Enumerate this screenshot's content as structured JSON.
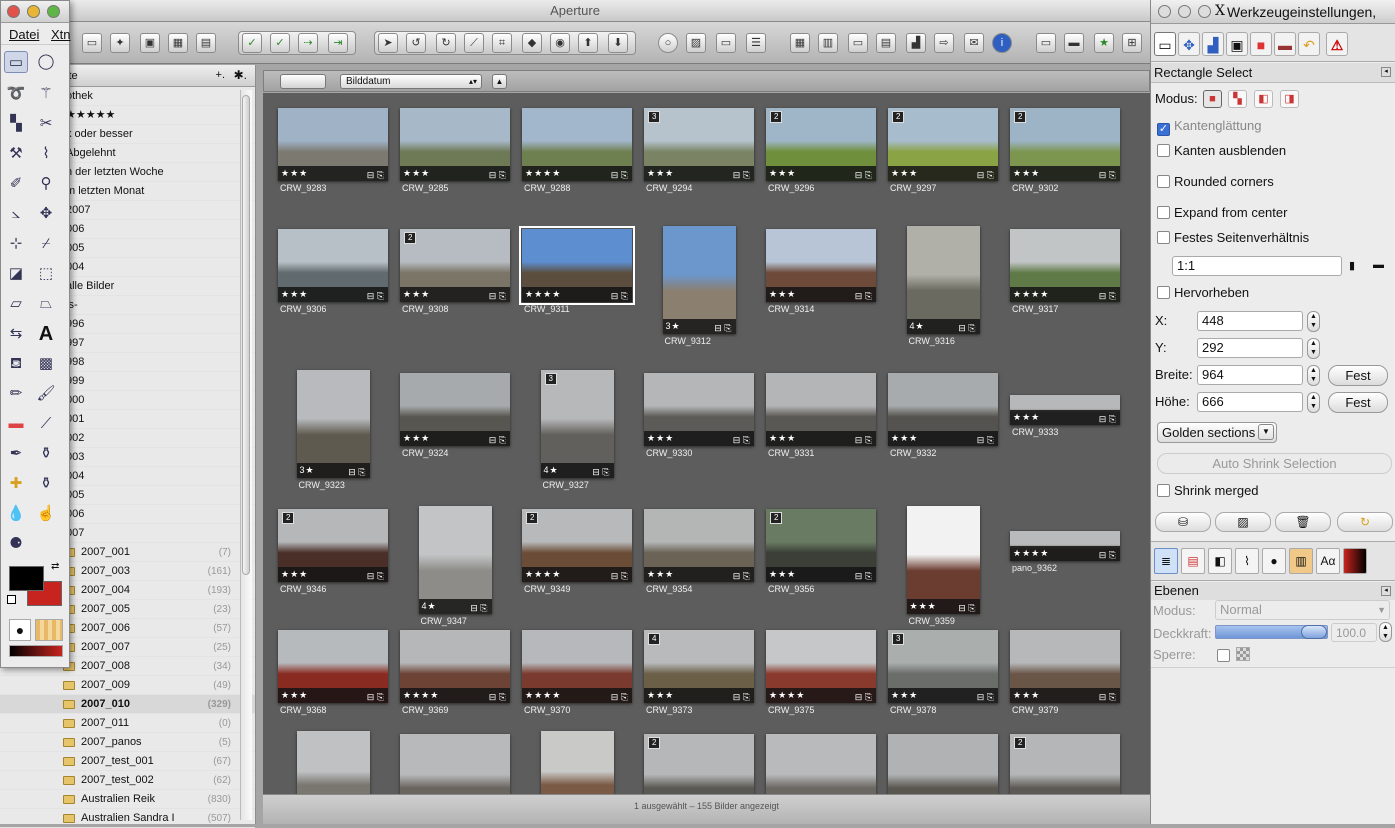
{
  "app": {
    "title": "Aperture"
  },
  "sidebar": {
    "header": "kte",
    "add": "+.",
    "gear": "✱.",
    "rows": [
      {
        "label": "othek",
        "type": "lib"
      },
      {
        "label": "★★★★★",
        "type": "smart"
      },
      {
        "label": "k oder besser",
        "type": "smart"
      },
      {
        "label": "Abgelehnt",
        "type": "smart"
      },
      {
        "label": "n der letzten Woche",
        "type": "smart"
      },
      {
        "label": "m letzten Monat",
        "type": "smart"
      },
      {
        "label": "2007",
        "type": "smart"
      },
      {
        "label": "006",
        "type": "smart"
      },
      {
        "label": "005",
        "type": "smart"
      },
      {
        "label": "004",
        "type": "smart"
      },
      {
        "label": "alle Bilder",
        "type": "smart"
      },
      {
        "label": "ls-",
        "type": "smart"
      },
      {
        "label": "996",
        "type": "smart"
      },
      {
        "label": "997",
        "type": "smart"
      },
      {
        "label": "998",
        "type": "smart"
      },
      {
        "label": "999",
        "type": "smart"
      },
      {
        "label": "000",
        "type": "smart"
      },
      {
        "label": "001",
        "type": "smart"
      },
      {
        "label": "002",
        "type": "smart"
      },
      {
        "label": "003",
        "type": "smart"
      },
      {
        "label": "004",
        "type": "smart"
      },
      {
        "label": "005",
        "type": "smart"
      },
      {
        "label": "006",
        "type": "smart"
      },
      {
        "label": "007",
        "type": "smart"
      },
      {
        "label": "2007_001",
        "count": "(7)",
        "type": "folder"
      },
      {
        "label": "2007_003",
        "count": "(161)",
        "type": "folder"
      },
      {
        "label": "2007_004",
        "count": "(193)",
        "type": "folder"
      },
      {
        "label": "2007_005",
        "count": "(23)",
        "type": "folder"
      },
      {
        "label": "2007_006",
        "count": "(57)",
        "type": "folder"
      },
      {
        "label": "2007_007",
        "count": "(25)",
        "type": "folder"
      },
      {
        "label": "2007_008",
        "count": "(34)",
        "type": "folder"
      },
      {
        "label": "2007_009",
        "count": "(49)",
        "type": "folder"
      },
      {
        "label": "2007_010",
        "count": "(329)",
        "type": "folder",
        "selected": true
      },
      {
        "label": "2007_011",
        "count": "(0)",
        "type": "folder"
      },
      {
        "label": "2007_panos",
        "count": "(5)",
        "type": "folder"
      },
      {
        "label": "2007_test_001",
        "count": "(67)",
        "type": "folder"
      },
      {
        "label": "2007_test_002",
        "count": "(62)",
        "type": "folder"
      },
      {
        "label": "Australien Reik",
        "count": "(830)",
        "type": "folder"
      },
      {
        "label": "Australien Sandra I",
        "count": "(507)",
        "type": "folder"
      }
    ]
  },
  "browser": {
    "sort_label": "Bilddatum",
    "status": "1 ausgewählt – 155 Bilder angezeigt",
    "thumbs": [
      {
        "name": "CRW_9283",
        "stars": "★★★",
        "badge": "",
        "c1": "#9fb2c6",
        "c2": "#7c7a70"
      },
      {
        "name": "CRW_9285",
        "stars": "★★★",
        "badge": "",
        "c1": "#a7b8c8",
        "c2": "#6e7a56"
      },
      {
        "name": "CRW_9288",
        "stars": "★★★★",
        "badge": "",
        "c1": "#a2b6cc",
        "c2": "#6f8050"
      },
      {
        "name": "CRW_9294",
        "stars": "★★★",
        "badge": "3",
        "c1": "#b6c2cc",
        "c2": "#7a8465"
      },
      {
        "name": "CRW_9296",
        "stars": "★★★",
        "badge": "2",
        "c1": "#9fb6c8",
        "c2": "#6f8f3c"
      },
      {
        "name": "CRW_9297",
        "stars": "★★★",
        "badge": "2",
        "c1": "#a7bccc",
        "c2": "#8aa345"
      },
      {
        "name": "CRW_9302",
        "stars": "★★★",
        "badge": "2",
        "c1": "#9db4c7",
        "c2": "#7c9650"
      },
      {
        "name": "CRW_9306",
        "stars": "★★★",
        "badge": "",
        "c1": "#b8c0c7",
        "c2": "#616a6e"
      },
      {
        "name": "CRW_9308",
        "stars": "★★★",
        "badge": "2",
        "c1": "#b6bcc1",
        "c2": "#7b7568"
      },
      {
        "name": "CRW_9311",
        "stars": "★★★★",
        "badge": "",
        "c1": "#5d8fd0",
        "c2": "#5b4e3f",
        "selected": true
      },
      {
        "name": "CRW_9312",
        "stars": "3★",
        "badge": "",
        "c1": "#6b97cc",
        "c2": "#8b7f70",
        "portrait": true
      },
      {
        "name": "CRW_9314",
        "stars": "★★★",
        "badge": "",
        "c1": "#b7c5d6",
        "c2": "#6d4a3a"
      },
      {
        "name": "CRW_9316",
        "stars": "4★",
        "badge": "",
        "c1": "#b0b0a8",
        "c2": "#6b6a60",
        "portrait": true
      },
      {
        "name": "CRW_9317",
        "stars": "★★★★",
        "badge": "",
        "c1": "#c2c5c6",
        "c2": "#5f7a47"
      },
      {
        "name": "CRW_9323",
        "stars": "3★",
        "badge": "",
        "c1": "#b8babd",
        "c2": "#5f5a50",
        "portrait": true
      },
      {
        "name": "CRW_9324",
        "stars": "★★★",
        "badge": "",
        "c1": "#a7aaac",
        "c2": "#585650"
      },
      {
        "name": "CRW_9327",
        "stars": "4★",
        "badge": "3",
        "c1": "#b7b8b9",
        "c2": "#62605c",
        "portrait": true
      },
      {
        "name": "CRW_9330",
        "stars": "★★★",
        "badge": "",
        "c1": "#b4b6b7",
        "c2": "#5d5b57"
      },
      {
        "name": "CRW_9331",
        "stars": "★★★",
        "badge": "",
        "c1": "#b3b5b6",
        "c2": "#5a5854"
      },
      {
        "name": "CRW_9332",
        "stars": "★★★",
        "badge": "",
        "c1": "#a8abad",
        "c2": "#55534f"
      },
      {
        "name": "CRW_9333",
        "stars": "★★★",
        "badge": "",
        "c1": "#b6b8b9",
        "c2": "#6a6863",
        "pano": true
      },
      {
        "name": "CRW_9346",
        "stars": "★★★",
        "badge": "2",
        "c1": "#b5b7b8",
        "c2": "#4a2e28"
      },
      {
        "name": "CRW_9347",
        "stars": "4★",
        "badge": "",
        "c1": "#c2c4c5",
        "c2": "#8d8c88",
        "portrait": true
      },
      {
        "name": "CRW_9349",
        "stars": "★★★★",
        "badge": "2",
        "c1": "#b7b9ba",
        "c2": "#6b4c36"
      },
      {
        "name": "CRW_9354",
        "stars": "★★★",
        "badge": "",
        "c1": "#b4b6b6",
        "c2": "#6a6356"
      },
      {
        "name": "CRW_9356",
        "stars": "★★★",
        "badge": "2",
        "c1": "#6a7b63",
        "c2": "#3b3f37"
      },
      {
        "name": "CRW_9359",
        "stars": "★★★",
        "badge": "",
        "c1": "#f2f2f2",
        "c2": "#6b3d30",
        "portrait": true
      },
      {
        "name": "pano_9362",
        "stars": "★★★★",
        "badge": "",
        "c1": "#b8babb",
        "c2": "#5b5448",
        "pano": true
      },
      {
        "name": "CRW_9368",
        "stars": "★★★",
        "badge": "",
        "c1": "#b7babd",
        "c2": "#8a2b22"
      },
      {
        "name": "CRW_9369",
        "stars": "★★★★",
        "badge": "",
        "c1": "#b5b7b9",
        "c2": "#6d4335"
      },
      {
        "name": "CRW_9370",
        "stars": "★★★★",
        "badge": "",
        "c1": "#b6b8bb",
        "c2": "#7a3a2d"
      },
      {
        "name": "CRW_9373",
        "stars": "★★★",
        "badge": "4",
        "c1": "#b8babb",
        "c2": "#6b5f48"
      },
      {
        "name": "CRW_9375",
        "stars": "★★★★",
        "badge": "",
        "c1": "#c5c7c9",
        "c2": "#8a3a2c"
      },
      {
        "name": "CRW_9378",
        "stars": "★★★",
        "badge": "3",
        "c1": "#aaaead",
        "c2": "#6a6d6a"
      },
      {
        "name": "CRW_9379",
        "stars": "★★★",
        "badge": "",
        "c1": "#b6b8ba",
        "c2": "#6a5647"
      },
      {
        "name": "",
        "stars": "",
        "badge": "",
        "c1": "#bfc1c3",
        "c2": "#7a7770",
        "portrait": true,
        "partial": true
      },
      {
        "name": "",
        "stars": "",
        "badge": "",
        "c1": "#b7b9ba",
        "c2": "#6b6560",
        "partial": true
      },
      {
        "name": "",
        "stars": "",
        "badge": "",
        "c1": "#c9c9c7",
        "c2": "#7a5a45",
        "portrait": true,
        "partial": true
      },
      {
        "name": "",
        "stars": "",
        "badge": "2",
        "c1": "#b5b7b8",
        "c2": "#5a5852",
        "partial": true
      },
      {
        "name": "",
        "stars": "",
        "badge": "",
        "c1": "#b8babb",
        "c2": "#6b6763",
        "partial": true
      },
      {
        "name": "",
        "stars": "",
        "badge": "",
        "c1": "#b0b2b4",
        "c2": "#5a5650",
        "partial": true
      },
      {
        "name": "",
        "stars": "",
        "badge": "2",
        "c1": "#b4b6b8",
        "c2": "#5d5a55",
        "partial": true
      }
    ]
  },
  "toolbox": {
    "menu": [
      "Datei",
      "Xtn"
    ]
  },
  "tooloptions": {
    "window_title": "Werkzeugeinstellungen,",
    "tool_name": "Rectangle Select",
    "mode_label": "Modus:",
    "antialias": "Kantenglättung",
    "feather": "Kanten ausblenden",
    "rounded": "Rounded corners",
    "expand": "Expand from center",
    "fixed": "Festes Seitenverhältnis",
    "ratio": "1:1",
    "highlight": "Hervorheben",
    "x_label": "X:",
    "x_value": "448",
    "y_label": "Y:",
    "y_value": "292",
    "w_label": "Breite:",
    "w_value": "964",
    "h_label": "Höhe:",
    "h_value": "666",
    "fest": "Fest",
    "guides": "Golden sections",
    "autoshrink": "Auto Shrink Selection",
    "shrink_merged": "Shrink merged"
  },
  "layers": {
    "title": "Ebenen",
    "mode_label": "Modus:",
    "mode_value": "Normal",
    "opacity_label": "Deckkraft:",
    "opacity_value": "100.0",
    "lock_label": "Sperre:"
  }
}
